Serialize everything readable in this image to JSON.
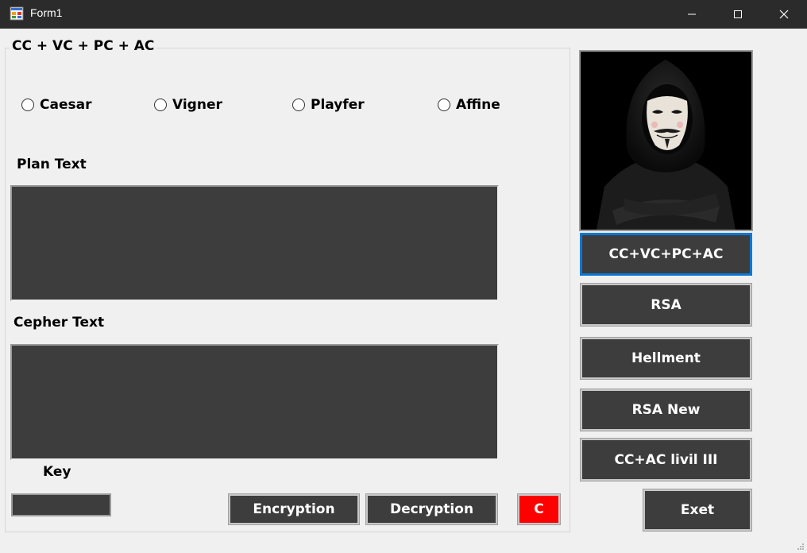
{
  "window": {
    "title": "Form1"
  },
  "group": {
    "legend": "CC + VC + PC + AC",
    "radios": [
      {
        "label": "Caesar",
        "checked": false
      },
      {
        "label": "Vigner",
        "checked": false
      },
      {
        "label": "Playfer",
        "checked": false
      },
      {
        "label": "Affine",
        "checked": false
      }
    ],
    "plain_label": "Plan Text",
    "plain_value": "",
    "cipher_label": "Cepher Text",
    "cipher_value": "",
    "key_label": "Key",
    "key_value": "",
    "encrypt_label": "Encryption",
    "decrypt_label": "Decryption",
    "clear_label": "C"
  },
  "side_buttons": [
    {
      "label": "CC+VC+PC+AC"
    },
    {
      "label": "RSA"
    },
    {
      "label": "Hellment"
    },
    {
      "label": "RSA New"
    },
    {
      "label": "CC+AC livil III"
    }
  ],
  "exit_label": "Exet",
  "colors": {
    "titlebar": "#2b2b2b",
    "control_dark": "#3d3d3d",
    "clear_button": "#ff0000",
    "focus_border": "#0a78d7"
  }
}
